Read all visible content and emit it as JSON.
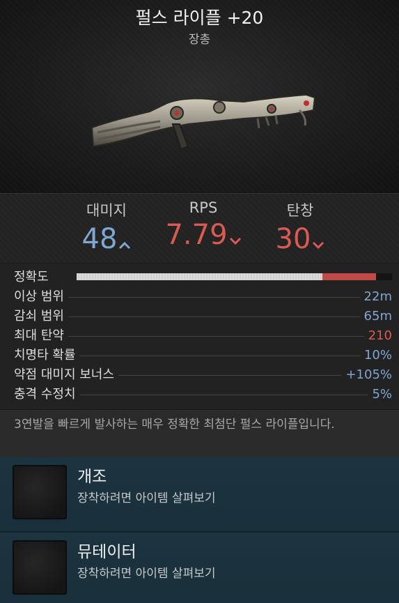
{
  "item": {
    "name": "펄스 라이플 +20",
    "type": "장총"
  },
  "stats": {
    "damage": {
      "label": "대미지",
      "value": "48",
      "trend": "up",
      "color": "#7fa7d2"
    },
    "rps": {
      "label": "RPS",
      "value": "7.79",
      "trend": "down",
      "color": "#dc5a54"
    },
    "magazine": {
      "label": "탄창",
      "value": "30",
      "trend": "down",
      "color": "#dc5a54"
    }
  },
  "accuracy": {
    "label": "정확도",
    "base_fraction": 0.78,
    "loss_fraction": 0.17
  },
  "attributes": [
    {
      "label": "이상 범위",
      "value": "22m",
      "status": "normal"
    },
    {
      "label": "감쇠 범위",
      "value": "65m",
      "status": "normal"
    },
    {
      "label": "최대 탄약",
      "value": "210",
      "status": "reduced"
    },
    {
      "label": "치명타 확률",
      "value": "10%",
      "status": "normal"
    },
    {
      "label": "약점 대미지 보너스",
      "value": "+105%",
      "status": "normal"
    },
    {
      "label": "충격 수정치",
      "value": "5%",
      "status": "normal"
    }
  ],
  "description": "3연발을 빠르게 발사하는 매우 정확한 최첨단 펄스 라이플입니다.",
  "slots": [
    {
      "name": "개조",
      "hint": "장착하려면 아이템 살펴보기"
    },
    {
      "name": "뮤테이터",
      "hint": "장착하려면 아이템 살펴보기"
    }
  ]
}
